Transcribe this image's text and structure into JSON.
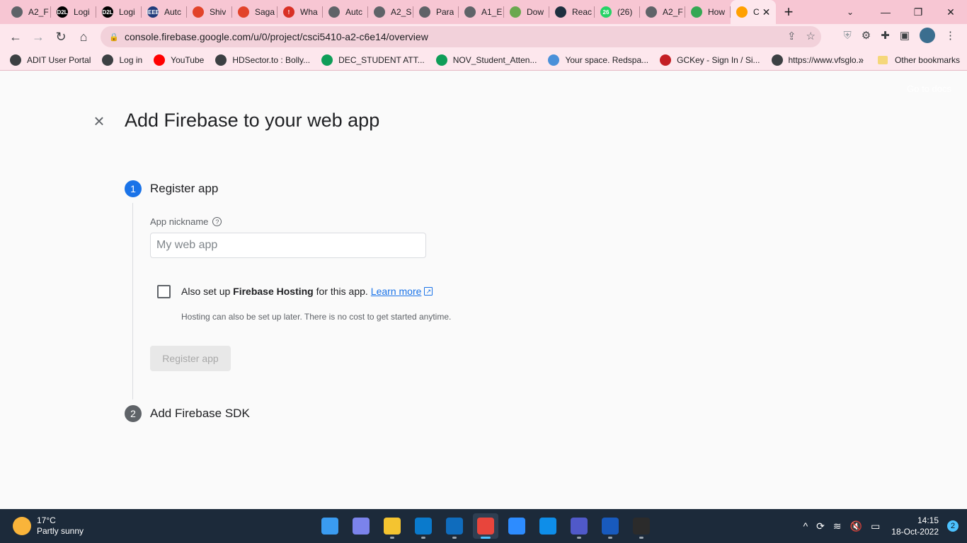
{
  "browser": {
    "tabs": [
      {
        "title": "A2_F",
        "color": "#5f6368"
      },
      {
        "title": "Logi",
        "color": "#000000",
        "badge": "D2L"
      },
      {
        "title": "Logi",
        "color": "#000000",
        "badge": "D2L"
      },
      {
        "title": "Autc",
        "color": "#1f3a7a",
        "badge": "IEEE"
      },
      {
        "title": "Shiv",
        "color": "#e2432a"
      },
      {
        "title": "Saga",
        "color": "#e2432a"
      },
      {
        "title": "Wha",
        "color": "#d93025",
        "badge": "!"
      },
      {
        "title": "Autc",
        "color": "#5f6368"
      },
      {
        "title": "A2_S",
        "color": "#5f6368"
      },
      {
        "title": "Para",
        "color": "#5f6368"
      },
      {
        "title": "A1_E",
        "color": "#5f6368"
      },
      {
        "title": "Dow",
        "color": "#6aa84f"
      },
      {
        "title": "Reac",
        "color": "#1e2f3f"
      },
      {
        "title": "(26)",
        "color": "#25d366",
        "badge": "26"
      },
      {
        "title": "A2_F",
        "color": "#5f6368"
      },
      {
        "title": "How",
        "color": "#34a853"
      },
      {
        "title": "C",
        "color": "#ffa000",
        "active": true
      }
    ],
    "url": "console.firebase.google.com/u/0/project/csci5410-a2-c6e14/overview",
    "bookmarks": [
      {
        "label": "ADIT User Portal",
        "color": "#3c4043"
      },
      {
        "label": "Log in",
        "color": "#3c4043"
      },
      {
        "label": "YouTube",
        "color": "#ff0000"
      },
      {
        "label": "HDSector.to : Bolly...",
        "color": "#3c4043"
      },
      {
        "label": "DEC_STUDENT ATT...",
        "color": "#0f9d58"
      },
      {
        "label": "NOV_Student_Atten...",
        "color": "#0f9d58"
      },
      {
        "label": "Your space. Redspa...",
        "color": "#4a90d9"
      },
      {
        "label": "GCKey - Sign In / Si...",
        "color": "#c41e24"
      },
      {
        "label": "https://www.vfsglo...",
        "color": "#3c4043"
      }
    ],
    "more_bookmarks": "»",
    "other_bookmarks": "Other bookmarks"
  },
  "page": {
    "goto_docs": "Go to docs",
    "title": "Add Firebase to your web app",
    "step1": {
      "number": "1",
      "title": "Register app"
    },
    "nickname_label": "App nickname",
    "nickname_placeholder": "My web app",
    "nickname_value": "",
    "hosting_prefix": "Also set up ",
    "hosting_bold": "Firebase Hosting",
    "hosting_suffix": " for this app.",
    "learn_more": "Learn more",
    "hosting_sub": "Hosting can also be set up later. There is no cost to get started anytime.",
    "register_button": "Register app",
    "step2": {
      "number": "2",
      "title": "Add Firebase SDK"
    }
  },
  "taskbar": {
    "temperature": "17°C",
    "weather": "Partly sunny",
    "apps": [
      {
        "name": "start",
        "color": "#3a9bf0"
      },
      {
        "name": "teams-chat",
        "color": "#7b83eb"
      },
      {
        "name": "file-explorer",
        "color": "#f4c430"
      },
      {
        "name": "vscode",
        "color": "#0a7acc"
      },
      {
        "name": "outlook",
        "color": "#0f6cbd"
      },
      {
        "name": "chrome",
        "color": "#e8453c",
        "active": true
      },
      {
        "name": "zoom",
        "color": "#2d8cff"
      },
      {
        "name": "teamviewer",
        "color": "#0e8ee9"
      },
      {
        "name": "teams",
        "color": "#5059c9"
      },
      {
        "name": "word",
        "color": "#185abd"
      },
      {
        "name": "terminal",
        "color": "#2b2b2b"
      }
    ],
    "time": "14:15",
    "date": "18-Oct-2022",
    "notifications": "2"
  }
}
